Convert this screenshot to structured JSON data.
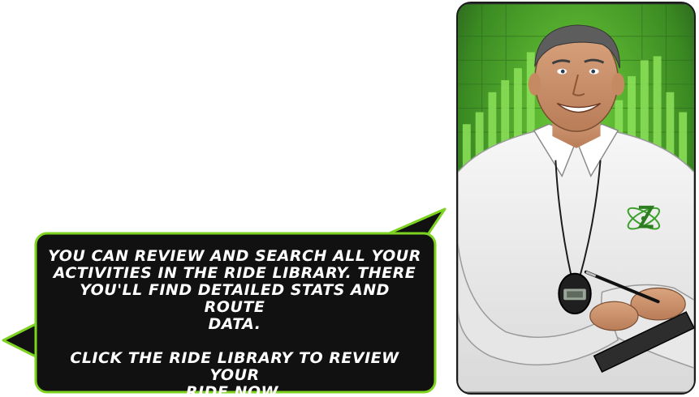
{
  "dialog": {
    "line1": "You can review and search all your",
    "line2": "activities in the Ride Library.  There",
    "line3": "you'll find detailed stats and route",
    "line4": "data.",
    "line5": "Click the Ride Library to review your",
    "line6": "ride now."
  },
  "colors": {
    "bubble_fill": "#111111",
    "bubble_border": "#7ed321",
    "accent_green": "#4caf2a",
    "shirt": "#f1f1f1"
  },
  "icons": {
    "logo": "atom-bicycle-logo",
    "stopwatch": "stopwatch-icon"
  }
}
